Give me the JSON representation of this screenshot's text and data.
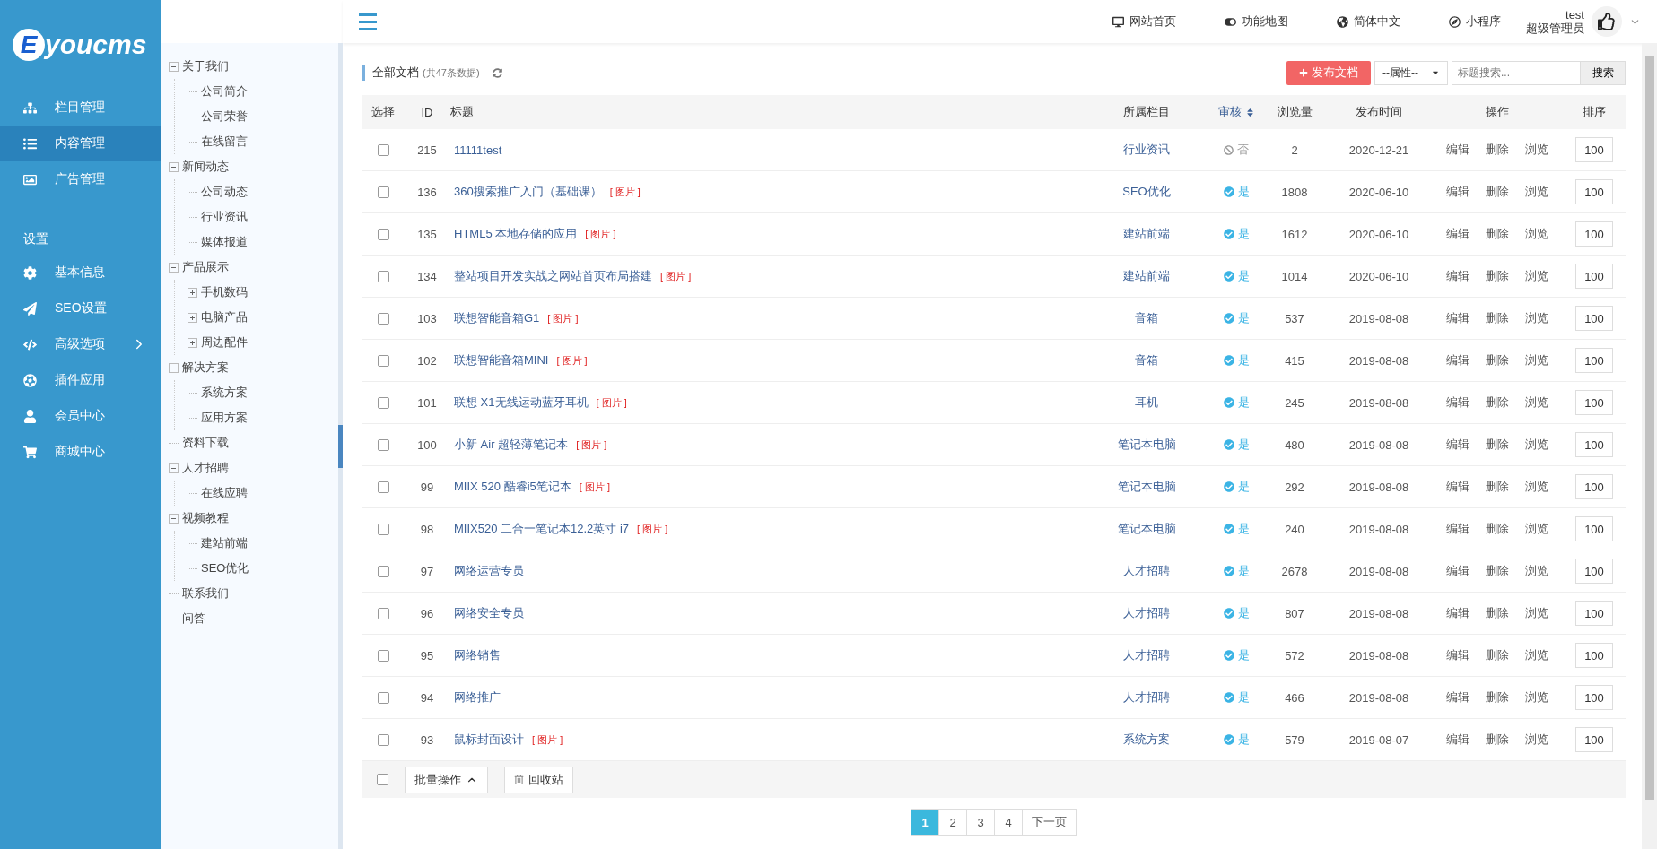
{
  "logo": {
    "mark": "E",
    "text": "youcms"
  },
  "sidebar": {
    "items": [
      {
        "label": "栏目管理",
        "selected": false,
        "submenu": false
      },
      {
        "label": "内容管理",
        "selected": true,
        "submenu": false
      },
      {
        "label": "广告管理",
        "selected": false,
        "submenu": false
      }
    ],
    "section": "设置",
    "settings": [
      {
        "label": "基本信息",
        "selected": false,
        "submenu": false
      },
      {
        "label": "SEO设置",
        "selected": false,
        "submenu": false
      },
      {
        "label": "高级选项",
        "selected": false,
        "submenu": true
      },
      {
        "label": "插件应用",
        "selected": false,
        "submenu": false
      },
      {
        "label": "会员中心",
        "selected": false,
        "submenu": false
      },
      {
        "label": "商城中心",
        "selected": false,
        "submenu": false
      }
    ]
  },
  "header": {
    "links": [
      "网站首页",
      "功能地图",
      "简体中文",
      "小程序"
    ],
    "user": {
      "name": "test",
      "role": "超级管理员"
    }
  },
  "tree": [
    {
      "label": "关于我们",
      "expanded": true,
      "children": [
        {
          "label": "公司简介"
        },
        {
          "label": "公司荣誉"
        },
        {
          "label": "在线留言"
        }
      ]
    },
    {
      "label": "新闻动态",
      "expanded": true,
      "children": [
        {
          "label": "公司动态"
        },
        {
          "label": "行业资讯"
        },
        {
          "label": "媒体报道"
        }
      ]
    },
    {
      "label": "产品展示",
      "expanded": true,
      "children": [
        {
          "label": "手机数码",
          "expanded": false
        },
        {
          "label": "电脑产品",
          "expanded": false
        },
        {
          "label": "周边配件",
          "expanded": false
        }
      ]
    },
    {
      "label": "解决方案",
      "expanded": true,
      "children": [
        {
          "label": "系统方案"
        },
        {
          "label": "应用方案"
        }
      ]
    },
    {
      "label": "资料下载"
    },
    {
      "label": "人才招聘",
      "expanded": true,
      "children": [
        {
          "label": "在线应聘"
        }
      ]
    },
    {
      "label": "视频教程",
      "expanded": true,
      "children": [
        {
          "label": "建站前端"
        },
        {
          "label": "SEO优化"
        }
      ]
    },
    {
      "label": "联系我们"
    },
    {
      "label": "问答"
    }
  ],
  "toolbar": {
    "title": "全部文档",
    "count": "(共47条数据)",
    "publish": "发布文档",
    "attribute": "--属性--",
    "search_placeholder": "标题搜索...",
    "search_button": "搜索"
  },
  "table": {
    "columns": [
      "选择",
      "ID",
      "标题",
      "所属栏目",
      "审核",
      "浏览量",
      "发布时间",
      "操作",
      "排序"
    ],
    "rows": [
      {
        "checked": false,
        "id": "215",
        "title": "11111test",
        "tag": "",
        "category": "行业资讯",
        "approved": false,
        "approval": "否",
        "views": "2",
        "date": "2020-12-21",
        "actions": [
          "编辑",
          "删除",
          "浏览"
        ],
        "sort": "100"
      },
      {
        "checked": false,
        "id": "136",
        "title": "360搜索推广入门（基础课）",
        "tag": "[ 图片 ]",
        "category": "SEO优化",
        "approved": true,
        "approval": "是",
        "views": "1808",
        "date": "2020-06-10",
        "actions": [
          "编辑",
          "删除",
          "浏览"
        ],
        "sort": "100"
      },
      {
        "checked": false,
        "id": "135",
        "title": "HTML5 本地存储的应用",
        "tag": "[ 图片 ]",
        "category": "建站前端",
        "approved": true,
        "approval": "是",
        "views": "1612",
        "date": "2020-06-10",
        "actions": [
          "编辑",
          "删除",
          "浏览"
        ],
        "sort": "100"
      },
      {
        "checked": false,
        "id": "134",
        "title": "整站项目开发实战之网站首页布局搭建",
        "tag": "[ 图片 ]",
        "category": "建站前端",
        "approved": true,
        "approval": "是",
        "views": "1014",
        "date": "2020-06-10",
        "actions": [
          "编辑",
          "删除",
          "浏览"
        ],
        "sort": "100"
      },
      {
        "checked": false,
        "id": "103",
        "title": "联想智能音箱G1",
        "tag": "[ 图片 ]",
        "category": "音箱",
        "approved": true,
        "approval": "是",
        "views": "537",
        "date": "2019-08-08",
        "actions": [
          "编辑",
          "删除",
          "浏览"
        ],
        "sort": "100"
      },
      {
        "checked": false,
        "id": "102",
        "title": "联想智能音箱MINI",
        "tag": "[ 图片 ]",
        "category": "音箱",
        "approved": true,
        "approval": "是",
        "views": "415",
        "date": "2019-08-08",
        "actions": [
          "编辑",
          "删除",
          "浏览"
        ],
        "sort": "100"
      },
      {
        "checked": false,
        "id": "101",
        "title": "联想 X1无线运动蓝牙耳机",
        "tag": "[ 图片 ]",
        "category": "耳机",
        "approved": true,
        "approval": "是",
        "views": "245",
        "date": "2019-08-08",
        "actions": [
          "编辑",
          "删除",
          "浏览"
        ],
        "sort": "100"
      },
      {
        "checked": false,
        "id": "100",
        "title": "小新 Air 超轻薄笔记本",
        "tag": "[ 图片 ]",
        "category": "笔记本电脑",
        "approved": true,
        "approval": "是",
        "views": "480",
        "date": "2019-08-08",
        "actions": [
          "编辑",
          "删除",
          "浏览"
        ],
        "sort": "100"
      },
      {
        "checked": false,
        "id": "99",
        "title": "MIIX 520 酷睿i5笔记本",
        "tag": "[ 图片 ]",
        "category": "笔记本电脑",
        "approved": true,
        "approval": "是",
        "views": "292",
        "date": "2019-08-08",
        "actions": [
          "编辑",
          "删除",
          "浏览"
        ],
        "sort": "100"
      },
      {
        "checked": false,
        "id": "98",
        "title": "MIIX520 二合一笔记本12.2英寸 i7",
        "tag": "[ 图片 ]",
        "category": "笔记本电脑",
        "approved": true,
        "approval": "是",
        "views": "240",
        "date": "2019-08-08",
        "actions": [
          "编辑",
          "删除",
          "浏览"
        ],
        "sort": "100"
      },
      {
        "checked": false,
        "id": "97",
        "title": "网络运营专员",
        "tag": "",
        "category": "人才招聘",
        "approved": true,
        "approval": "是",
        "views": "2678",
        "date": "2019-08-08",
        "actions": [
          "编辑",
          "删除",
          "浏览"
        ],
        "sort": "100"
      },
      {
        "checked": false,
        "id": "96",
        "title": "网络安全专员",
        "tag": "",
        "category": "人才招聘",
        "approved": true,
        "approval": "是",
        "views": "807",
        "date": "2019-08-08",
        "actions": [
          "编辑",
          "删除",
          "浏览"
        ],
        "sort": "100"
      },
      {
        "checked": false,
        "id": "95",
        "title": "网络销售",
        "tag": "",
        "category": "人才招聘",
        "approved": true,
        "approval": "是",
        "views": "572",
        "date": "2019-08-08",
        "actions": [
          "编辑",
          "删除",
          "浏览"
        ],
        "sort": "100"
      },
      {
        "checked": false,
        "id": "94",
        "title": "网络推广",
        "tag": "",
        "category": "人才招聘",
        "approved": true,
        "approval": "是",
        "views": "466",
        "date": "2019-08-08",
        "actions": [
          "编辑",
          "删除",
          "浏览"
        ],
        "sort": "100"
      },
      {
        "checked": false,
        "id": "93",
        "title": "鼠标封面设计",
        "tag": "[ 图片 ]",
        "category": "系统方案",
        "approved": true,
        "approval": "是",
        "views": "579",
        "date": "2019-08-07",
        "actions": [
          "编辑",
          "删除",
          "浏览"
        ],
        "sort": "100"
      }
    ]
  },
  "footer": {
    "select_all": {
      "checked": false
    },
    "batch": "批量操作",
    "recycle": "回收站"
  },
  "pagination": {
    "pages": [
      {
        "label": "1",
        "selected": true
      },
      {
        "label": "2",
        "selected": false
      },
      {
        "label": "3",
        "selected": false
      },
      {
        "label": "4",
        "selected": false
      }
    ],
    "next": "下一页"
  }
}
